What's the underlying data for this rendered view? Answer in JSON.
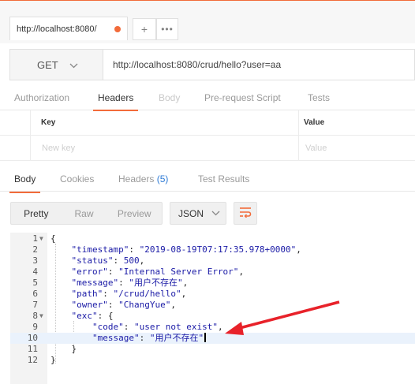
{
  "tabs": {
    "request_tab_label": "http://localhost:8080/",
    "plus": "+",
    "more": "•••"
  },
  "request": {
    "method": "GET",
    "url": "http://localhost:8080/crud/hello?user=aa"
  },
  "request_tabs": [
    "Authorization",
    "Headers",
    "Body",
    "Pre-request Script",
    "Tests"
  ],
  "headers_table": {
    "key_header": "Key",
    "value_header": "Value",
    "key_placeholder": "New key",
    "value_placeholder": "Value"
  },
  "response_tabs": {
    "body": "Body",
    "cookies": "Cookies",
    "headers": "Headers",
    "headers_count": "(5)",
    "tests": "Test Results"
  },
  "view_modes": [
    "Pretty",
    "Raw",
    "Preview"
  ],
  "format": "JSON",
  "code": {
    "line_numbers": [
      "1",
      "2",
      "3",
      "4",
      "5",
      "6",
      "7",
      "8",
      "9",
      "10",
      "11",
      "12"
    ],
    "timestamp_key": "\"timestamp\"",
    "timestamp_val": "\"2019-08-19T07:17:35.978+0000\"",
    "status_key": "\"status\"",
    "status_val": "500",
    "error_key": "\"error\"",
    "error_val": "\"Internal Server Error\"",
    "message_key": "\"message\"",
    "message_val": "\"用户不存在\"",
    "path_key": "\"path\"",
    "path_val": "\"/crud/hello\"",
    "owner_key": "\"owner\"",
    "owner_val": "\"ChangYue\"",
    "exc_key": "\"exc\"",
    "code_key": "\"code\"",
    "code_val": "\"user not exist\"",
    "inner_message_key": "\"message\"",
    "inner_message_val": "\"用户不存在\""
  },
  "colors": {
    "accent": "#f26b3a",
    "arrow": "#e8222a",
    "count": "#2e7bd6"
  }
}
